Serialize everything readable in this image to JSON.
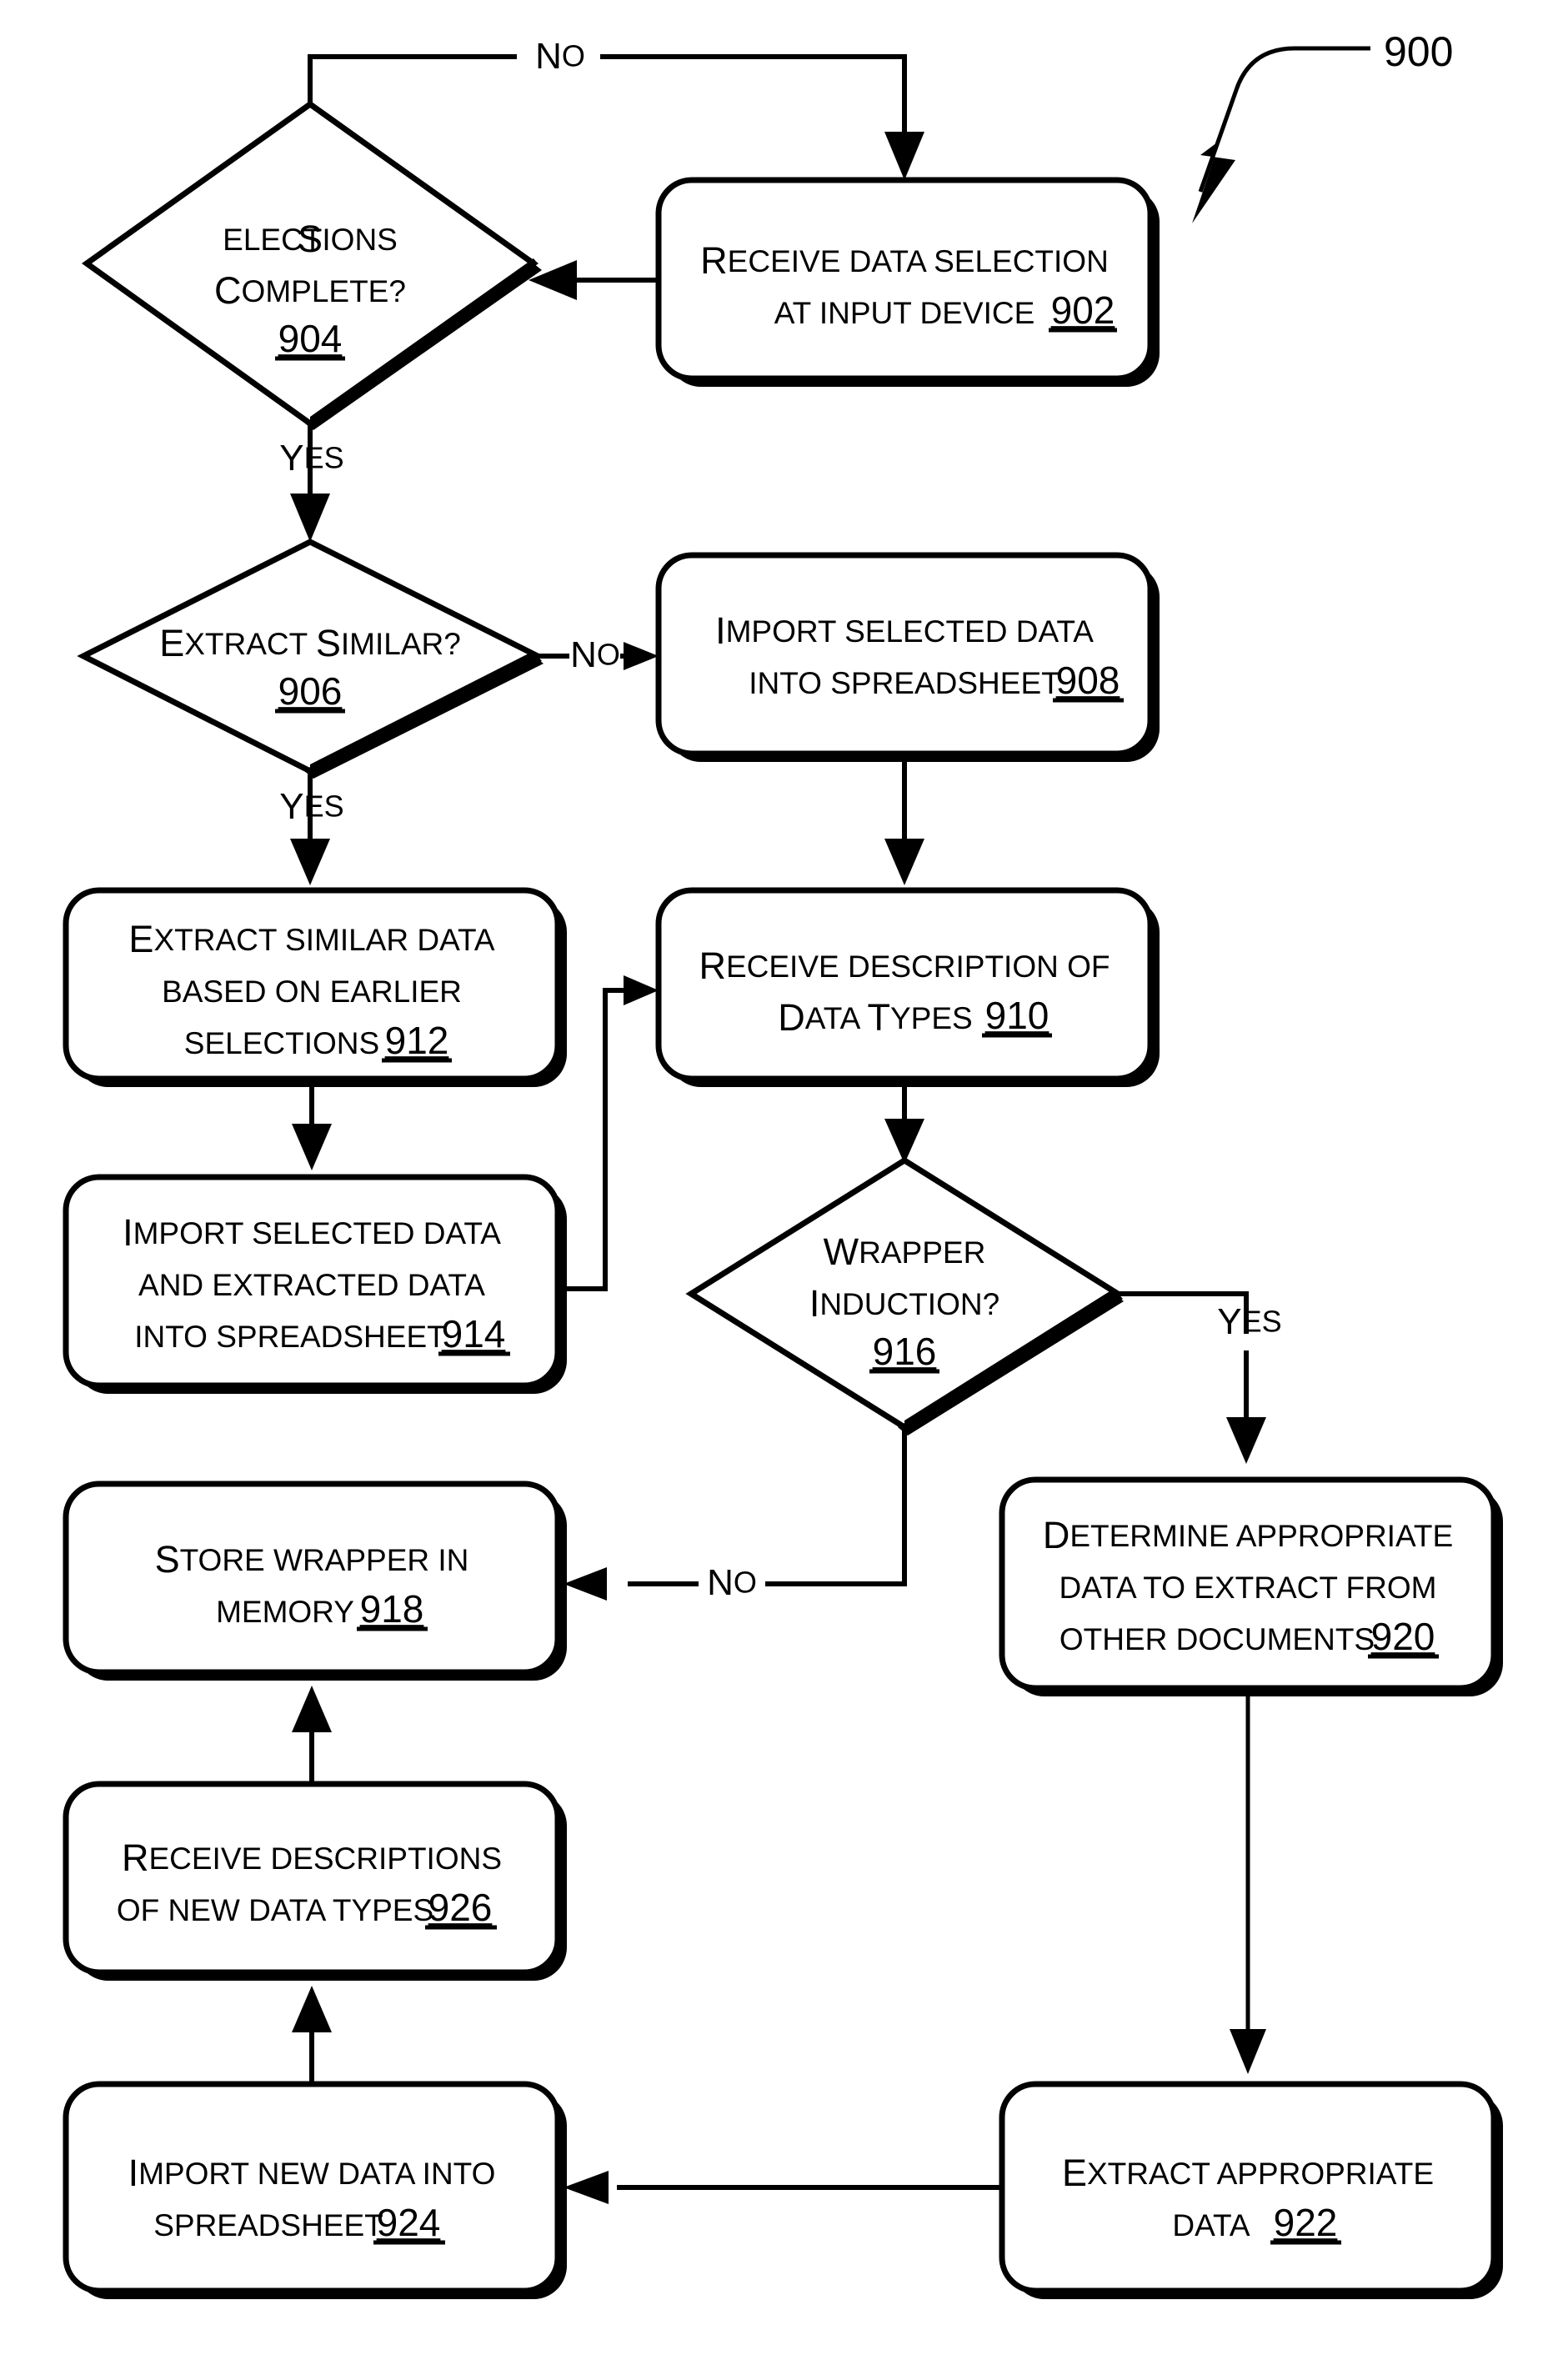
{
  "figure": {
    "number": "900",
    "type": "flowchart",
    "title": ""
  },
  "nodes": [
    {
      "id": "902",
      "kind": "process",
      "lines": [
        "Receive data selection",
        "at input device"
      ],
      "ref": "902"
    },
    {
      "id": "904",
      "kind": "decision",
      "lines": [
        "Selections",
        "Complete?"
      ],
      "ref": "904"
    },
    {
      "id": "906",
      "kind": "decision",
      "lines": [
        "Extract Similar?"
      ],
      "ref": "906"
    },
    {
      "id": "908",
      "kind": "process",
      "lines": [
        "Import selected data",
        "into spreadsheet"
      ],
      "ref": "908"
    },
    {
      "id": "910",
      "kind": "process",
      "lines": [
        "Receive description of",
        "Data Types"
      ],
      "ref": "910"
    },
    {
      "id": "912",
      "kind": "process",
      "lines": [
        "Extract similar data",
        "based on earlier",
        "selections"
      ],
      "ref": "912"
    },
    {
      "id": "914",
      "kind": "process",
      "lines": [
        "Import selected data",
        "and extracted data",
        "into spreadsheet"
      ],
      "ref": "914"
    },
    {
      "id": "916",
      "kind": "decision",
      "lines": [
        "Wrapper",
        "Induction?"
      ],
      "ref": "916"
    },
    {
      "id": "918",
      "kind": "process",
      "lines": [
        "Store wrapper in",
        "memory"
      ],
      "ref": "918"
    },
    {
      "id": "920",
      "kind": "process",
      "lines": [
        "Determine appropriate",
        "data to extract from",
        "other documents"
      ],
      "ref": "920"
    },
    {
      "id": "922",
      "kind": "process",
      "lines": [
        "Extract appropriate",
        "data"
      ],
      "ref": "922"
    },
    {
      "id": "924",
      "kind": "process",
      "lines": [
        "Import new data into",
        "spreadsheet"
      ],
      "ref": "924"
    },
    {
      "id": "926",
      "kind": "process",
      "lines": [
        "Receive descriptions",
        "of new data types"
      ],
      "ref": "926"
    }
  ],
  "edges": [
    {
      "id": "e904-902-no",
      "from": "904",
      "to": "902",
      "label": "No"
    },
    {
      "id": "e902-904",
      "from": "902",
      "to": "904",
      "label": ""
    },
    {
      "id": "e904-906-yes",
      "from": "904",
      "to": "906",
      "label": "Yes"
    },
    {
      "id": "e906-908-no",
      "from": "906",
      "to": "908",
      "label": "No"
    },
    {
      "id": "e906-912-yes",
      "from": "906",
      "to": "912",
      "label": "Yes"
    },
    {
      "id": "e908-910",
      "from": "908",
      "to": "910",
      "label": ""
    },
    {
      "id": "e912-914",
      "from": "912",
      "to": "914",
      "label": ""
    },
    {
      "id": "e914-910",
      "from": "914",
      "to": "910",
      "label": ""
    },
    {
      "id": "e910-916",
      "from": "910",
      "to": "916",
      "label": ""
    },
    {
      "id": "e916-920-yes",
      "from": "916",
      "to": "920",
      "label": "Yes"
    },
    {
      "id": "e916-918-no",
      "from": "916",
      "to": "918",
      "label": "No"
    },
    {
      "id": "e920-922",
      "from": "920",
      "to": "922",
      "label": ""
    },
    {
      "id": "e922-924",
      "from": "922",
      "to": "924",
      "label": ""
    },
    {
      "id": "e924-926",
      "from": "924",
      "to": "926",
      "label": ""
    },
    {
      "id": "e926-918",
      "from": "926",
      "to": "918",
      "label": ""
    }
  ],
  "labels": {
    "no_top": "No",
    "yes_904": "Yes",
    "no_906": "No",
    "yes_906": "Yes",
    "yes_916": "Yes",
    "no_916": "No"
  },
  "text_902_l1": "Receive data selection",
  "text_902_l2": "at input device",
  "ref_902": "902",
  "text_904_l1": "Selections",
  "text_904_l2": "Complete?",
  "ref_904": "904",
  "text_906_l1": "Extract Similar?",
  "ref_906": "906",
  "text_908_l1": "Import selected data",
  "text_908_l2": "into spreadsheet",
  "ref_908": "908",
  "text_910_l1": "Receive description of",
  "text_910_l2": "Data Types",
  "ref_910": "910",
  "text_912_l1": "Extract similar data",
  "text_912_l2": "based on earlier",
  "text_912_l3": "selections",
  "ref_912": "912",
  "text_914_l1": "Import selected data",
  "text_914_l2": "and extracted data",
  "text_914_l3": "into spreadsheet",
  "ref_914": "914",
  "text_916_l1": "Wrapper",
  "text_916_l2": "Induction?",
  "ref_916": "916",
  "text_918_l1": "Store wrapper in",
  "text_918_l2": "memory",
  "ref_918": "918",
  "text_920_l1": "Determine appropriate",
  "text_920_l2": "data to extract from",
  "text_920_l3": "other documents",
  "ref_920": "920",
  "text_922_l1": "Extract appropriate",
  "text_922_l2": "data",
  "ref_922": "922",
  "text_924_l1": "Import new data into",
  "text_924_l2": "spreadsheet",
  "ref_924": "924",
  "text_926_l1": "Receive descriptions",
  "text_926_l2": "of new data types",
  "ref_926": "926",
  "fig_ref": "900",
  "colors": {
    "ink": "#000000",
    "paper": "#ffffff"
  }
}
